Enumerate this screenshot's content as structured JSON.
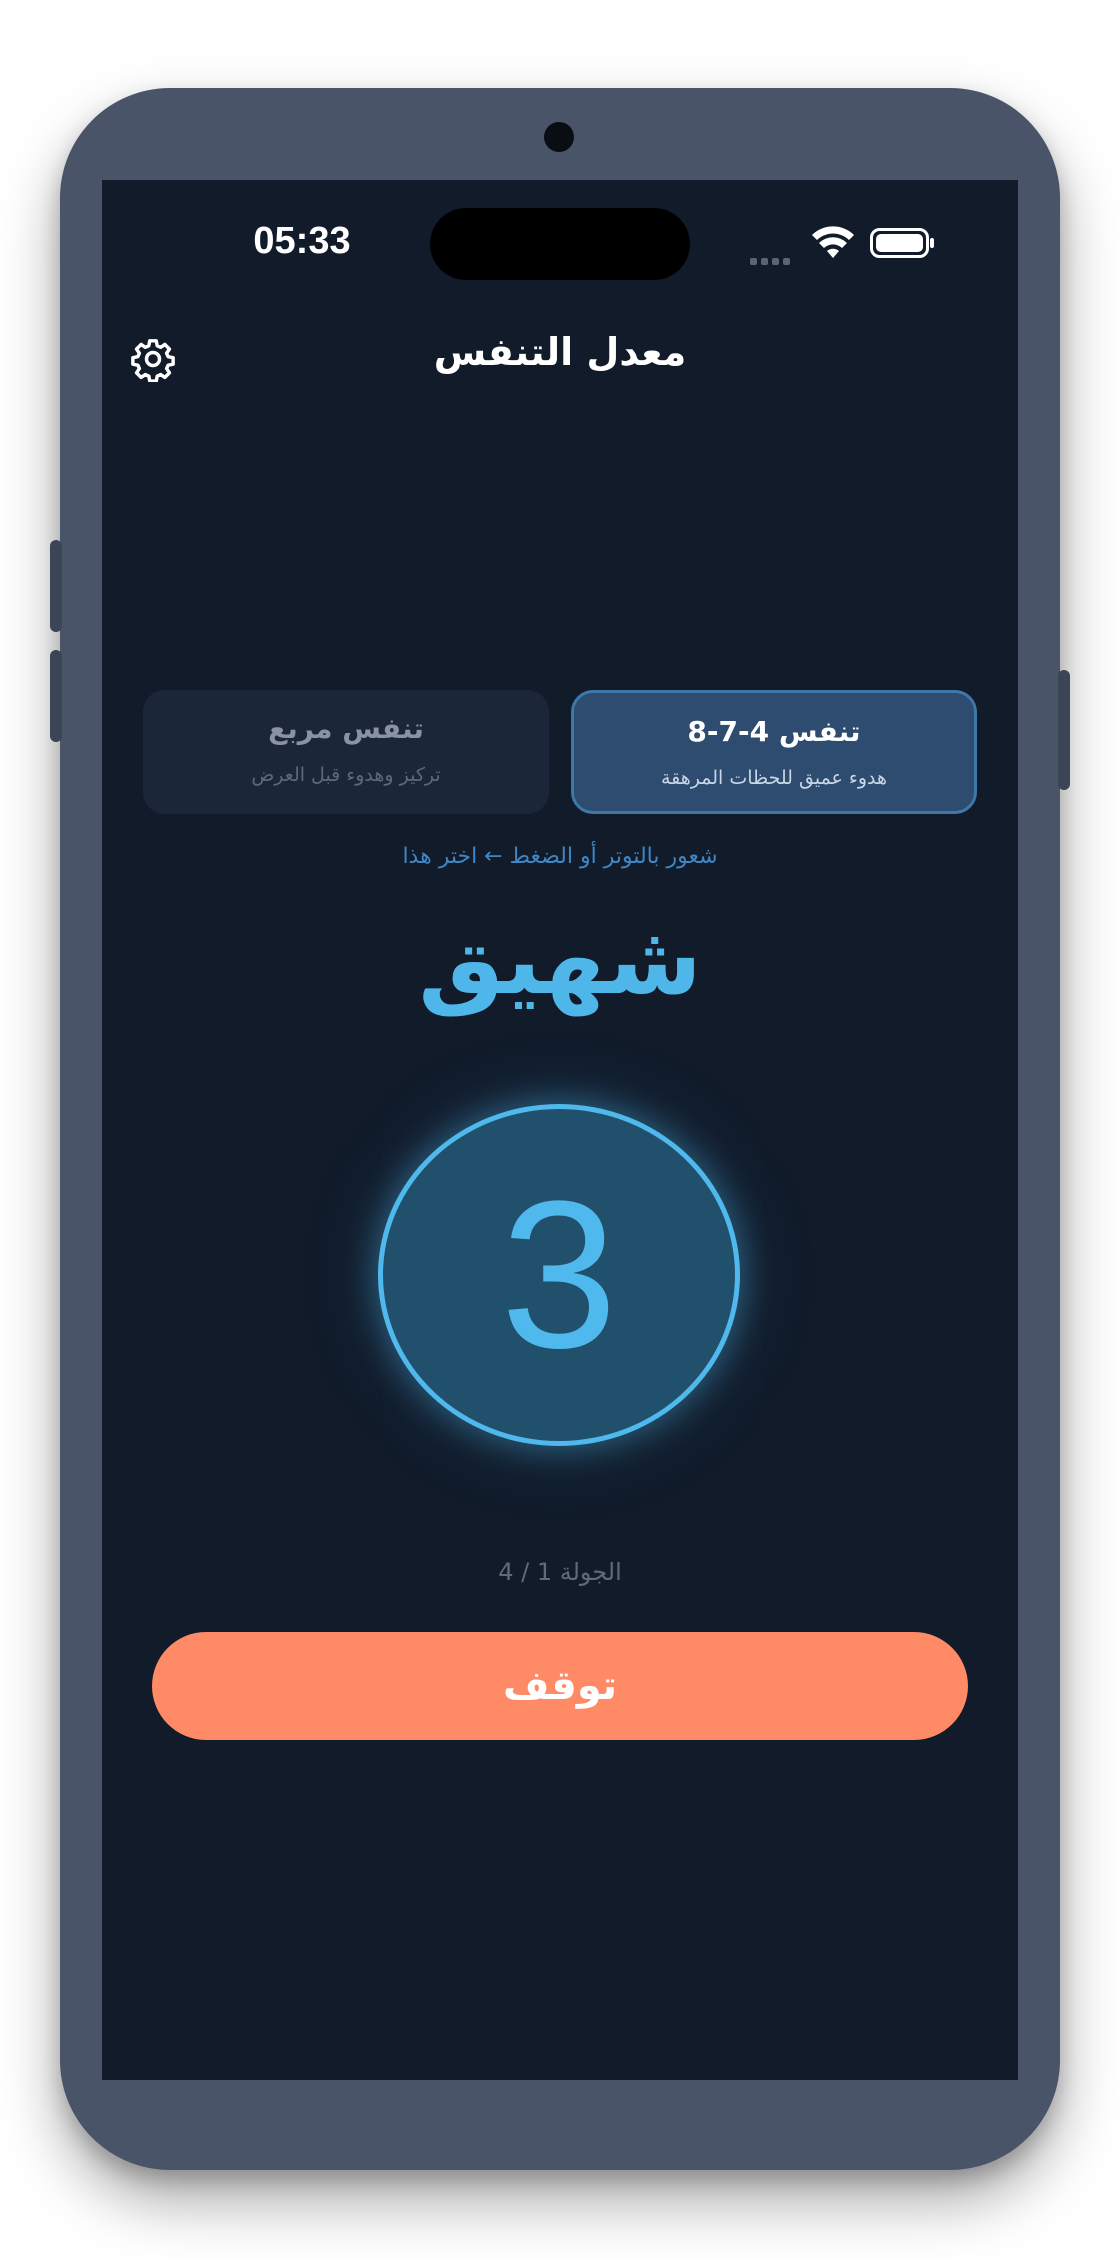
{
  "status_bar": {
    "time": "05:33"
  },
  "header": {
    "title": "معدل التنفس",
    "settings_icon": "gear-icon"
  },
  "techniques": [
    {
      "title": "تنفس 4-7-8",
      "subtitle": "هدوء عميق للحظات المرهقة",
      "selected": true
    },
    {
      "title": "تنفس مربع",
      "subtitle": "تركيز وهدوء قبل العرض",
      "selected": false
    }
  ],
  "hint": "شعور بالتوتر أو الضغط ← اختر هذا",
  "session": {
    "phase": "شهيق",
    "count": "3",
    "round_text": "الجولة 1 / 4"
  },
  "actions": {
    "stop_label": "توقف"
  },
  "colors": {
    "background": "#111b2a",
    "accent": "#4fb8ec",
    "stop_button": "#fe8a66",
    "selected_card": "#2d4c70"
  }
}
